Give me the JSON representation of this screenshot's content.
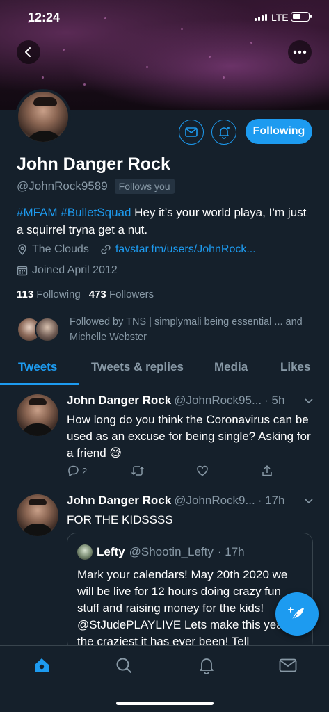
{
  "status_bar": {
    "time": "12:24",
    "network": "LTE"
  },
  "profile": {
    "name": "John Danger Rock",
    "handle": "@JohnRock9589",
    "follows_you_label": "Follows you",
    "bio_tags": [
      "#MFAM",
      "#BulletSquad"
    ],
    "bio_text": " Hey it’s your world playa, I’m just a squirrel tryna get a nut.",
    "location": "The Clouds",
    "website": "favstar.fm/users/JohnRock...",
    "joined": "Joined April 2012",
    "following_count": "113",
    "following_label": "Following",
    "followers_count": "473",
    "followers_label": "Followers",
    "followed_by_text": "Followed by TNS | simplymali being essential ... and Michelle Webster",
    "following_button_label": "Following"
  },
  "tabs": [
    {
      "label": "Tweets",
      "active": true
    },
    {
      "label": "Tweets & replies",
      "active": false
    },
    {
      "label": "Media",
      "active": false
    },
    {
      "label": "Likes",
      "active": false
    }
  ],
  "tweets": [
    {
      "name": "John Danger Rock",
      "handle": "@JohnRock95...",
      "time": "· 5h",
      "text": "How long do you think the Coronavirus can be used as an excuse for being single? Asking for a friend 😅",
      "reply_count": "2"
    },
    {
      "name": "John Danger Rock",
      "handle": "@JohnRock9...",
      "time": "· 17h",
      "text": "FOR THE KIDSSSS",
      "quote": {
        "name": "Lefty",
        "handle": "@Shootin_Lefty",
        "time": "· 17h",
        "text": "Mark your calendars! May 20th 2020 we will be live for 12 hours doing crazy fun stuff and raising money for the kids! @StJudePLAYLIVE Lets make this year the craziest it has ever been! Tell"
      }
    }
  ],
  "colors": {
    "accent": "#1d9bf0",
    "background": "#15202b",
    "muted": "#8899a6",
    "border": "#38444d"
  }
}
